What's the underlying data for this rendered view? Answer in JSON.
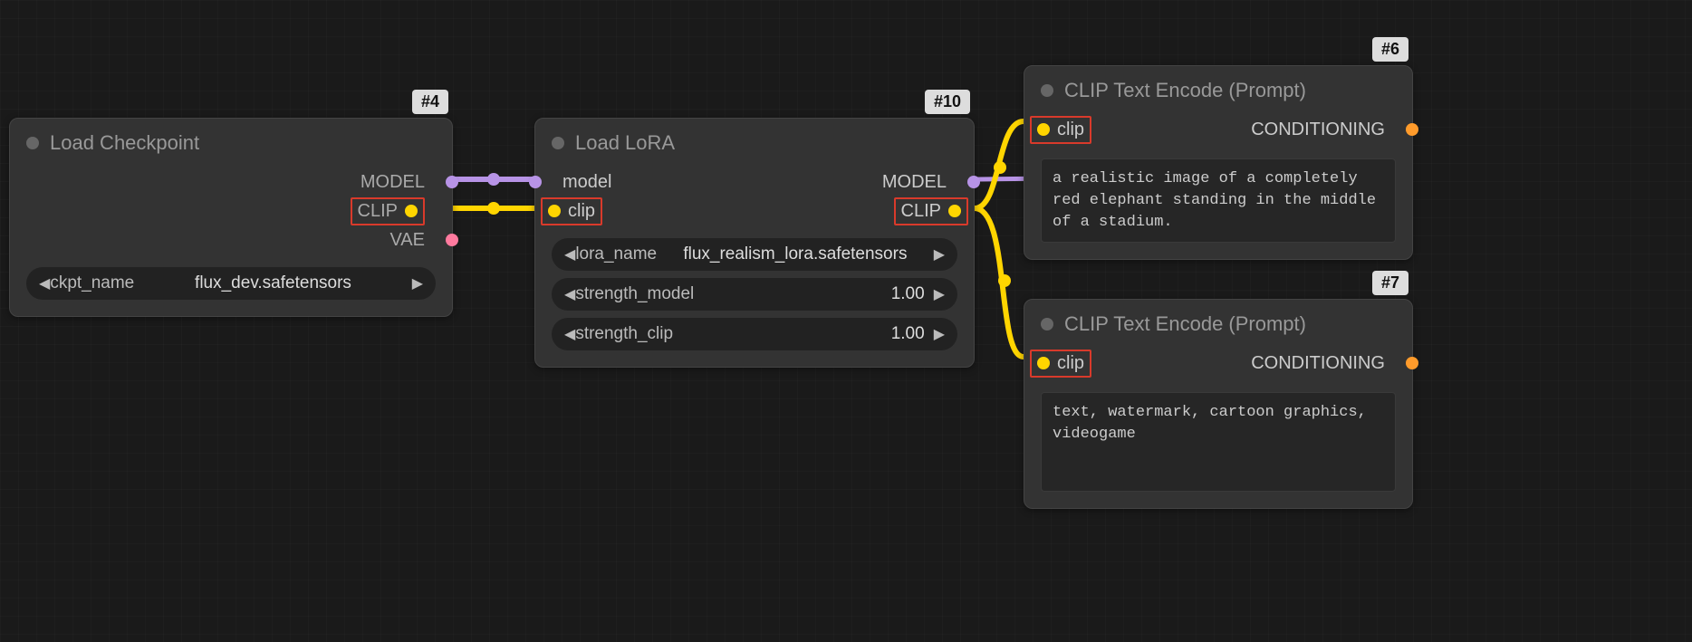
{
  "nodes": {
    "load_checkpoint": {
      "tag": "#4",
      "title": "Load Checkpoint",
      "outputs": {
        "model": "MODEL",
        "clip": "CLIP",
        "vae": "VAE"
      },
      "widgets": {
        "ckpt_name": {
          "label": "ckpt_name",
          "value": "flux_dev.safetensors"
        }
      }
    },
    "load_lora": {
      "tag": "#10",
      "title": "Load LoRA",
      "inputs": {
        "model": "model",
        "clip": "clip"
      },
      "outputs": {
        "model": "MODEL",
        "clip": "CLIP"
      },
      "widgets": {
        "lora_name": {
          "label": "lora_name",
          "value": "flux_realism_lora.safetensors"
        },
        "strength_model": {
          "label": "strength_model",
          "value": "1.00"
        },
        "strength_clip": {
          "label": "strength_clip",
          "value": "1.00"
        }
      }
    },
    "clip_encode_pos": {
      "tag": "#6",
      "title": "CLIP Text Encode (Prompt)",
      "inputs": {
        "clip": "clip"
      },
      "outputs": {
        "conditioning": "CONDITIONING"
      },
      "text": "a realistic image of a completely red elephant standing in the middle of a stadium."
    },
    "clip_encode_neg": {
      "tag": "#7",
      "title": "CLIP Text Encode (Prompt)",
      "inputs": {
        "clip": "clip"
      },
      "outputs": {
        "conditioning": "CONDITIONING"
      },
      "text": "text, watermark, cartoon graphics, videogame"
    }
  }
}
